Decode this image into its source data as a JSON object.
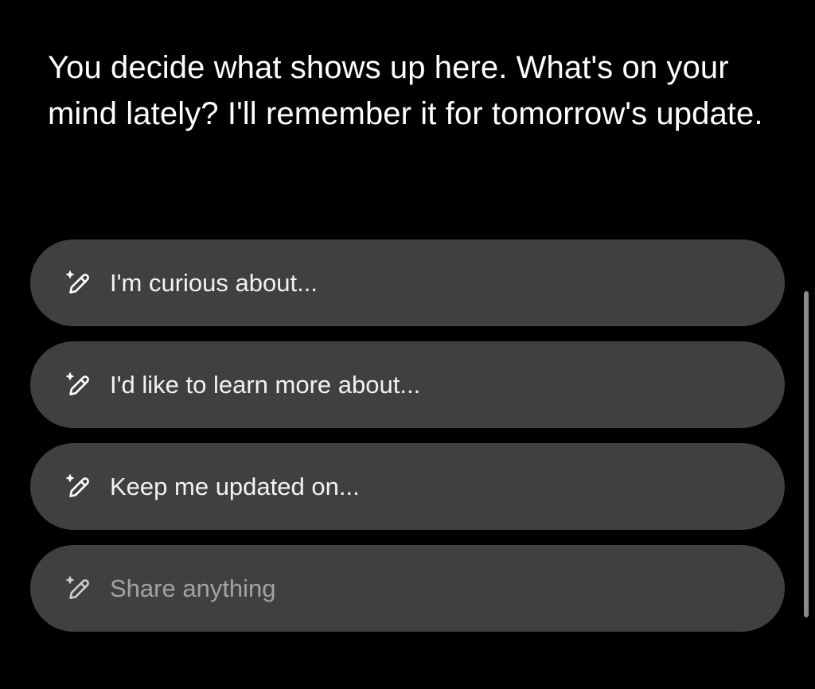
{
  "prompt": {
    "text": "You decide what shows up here. What's on your mind lately? I'll remember it for tomorrow's update."
  },
  "options": [
    {
      "label": "I'm curious about...",
      "icon": "sparkle-pencil-icon"
    },
    {
      "label": "I'd like to learn more about...",
      "icon": "sparkle-pencil-icon"
    },
    {
      "label": "Keep me updated on...",
      "icon": "sparkle-pencil-icon"
    }
  ],
  "share_input": {
    "placeholder": "Share anything",
    "icon": "sparkle-pencil-icon"
  },
  "colors": {
    "background": "#000000",
    "pill": "#404040",
    "text": "#ffffff",
    "placeholder": "#a3a3a3"
  }
}
